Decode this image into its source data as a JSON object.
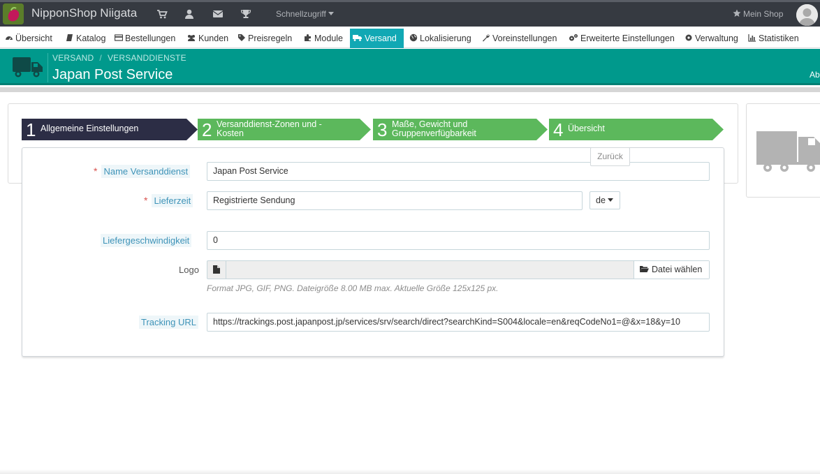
{
  "topbar": {
    "shop_name": "NipponShop Niigata",
    "quick_access": "Schnellzugriff",
    "my_shop": "Mein Shop",
    "icons": [
      "cart-icon",
      "user-icon",
      "envelope-icon",
      "trophy-icon"
    ]
  },
  "nav": {
    "items": [
      {
        "label": "Übersicht",
        "icon": "dashboard-icon"
      },
      {
        "label": "Katalog",
        "icon": "book-icon"
      },
      {
        "label": "Bestellungen",
        "icon": "credit-card-icon"
      },
      {
        "label": "Kunden",
        "icon": "users-icon"
      },
      {
        "label": "Preisregeln",
        "icon": "tag-icon"
      },
      {
        "label": "Module",
        "icon": "puzzle-icon"
      },
      {
        "label": "Versand",
        "icon": "truck-icon"
      },
      {
        "label": "Lokalisierung",
        "icon": "globe-icon"
      },
      {
        "label": "Voreinstellungen",
        "icon": "wrench-icon"
      },
      {
        "label": "Erweiterte Einstellungen",
        "icon": "cogs-icon"
      },
      {
        "label": "Verwaltung",
        "icon": "cog-icon"
      },
      {
        "label": "Statistiken",
        "icon": "bar-chart-icon"
      }
    ],
    "active": "Versand"
  },
  "header": {
    "breadcrumb": [
      "VERSAND",
      "VERSANDDIENSTE"
    ],
    "breadcrumb_sep": "/",
    "title": "Japan Post Service",
    "right_text": "Ab"
  },
  "wizard": {
    "steps": [
      {
        "number": "1",
        "label": "Allgemeine Einstellungen",
        "active": true
      },
      {
        "number": "2",
        "label_lines": [
          "Versanddienst-Zonen und -",
          "Kosten"
        ],
        "active": false
      },
      {
        "number": "3",
        "label_lines": [
          "Maße, Gewicht und",
          "Gruppenverfügbarkeit"
        ],
        "active": false
      },
      {
        "number": "4",
        "label": "Übersicht",
        "active": false
      }
    ],
    "back_button": "Zurück",
    "colors": {
      "active": "#2c3e50",
      "inactive": "#5cb85c"
    }
  },
  "form": {
    "name": {
      "label": "Name Versanddienst",
      "required": true,
      "value": "Japan Post Service"
    },
    "delivery_time": {
      "label": "Lieferzeit",
      "required": true,
      "value": "Registrierte Sendung",
      "lang": "de"
    },
    "speed": {
      "label": "Liefergeschwindigkeit",
      "value": "0"
    },
    "logo": {
      "label": "Logo",
      "button": "Datei wählen",
      "help": "Format JPG, GIF, PNG. Dateigröße 8.00 MB max. Aktuelle Größe 125x125 px."
    },
    "tracking": {
      "label": "Tracking URL",
      "value": "https://trackings.post.japanpost.jp/services/srv/search/direct?searchKind=S004&locale=en&reqCodeNo1=@&x=18&y=10"
    }
  },
  "colors": {
    "header": "#00998c",
    "nav_active": "#11a8b4",
    "label_blue": "#3e93b8",
    "required": "#d9534f"
  }
}
